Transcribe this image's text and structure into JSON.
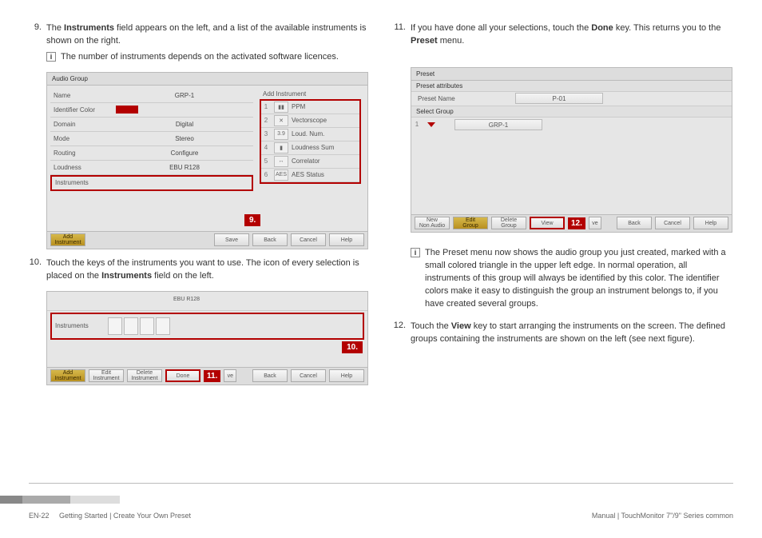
{
  "step9": {
    "num": "9.",
    "text_before": "The ",
    "bold1": "Instruments",
    "text_after": " field appears on the left, and a list of the available instruments is shown on the right."
  },
  "note9": "The number of instruments depends on the activated software licences.",
  "fig9": {
    "title": "Audio Group",
    "rows": {
      "name_lbl": "Name",
      "name_val": "GRP-1",
      "color_lbl": "Identifier Color",
      "domain_lbl": "Domain",
      "domain_val": "Digital",
      "mode_lbl": "Mode",
      "mode_val": "Stereo",
      "routing_lbl": "Routing",
      "routing_val": "Configure",
      "loud_lbl": "Loudness",
      "loud_val": "EBU R128",
      "instr_lbl": "Instruments"
    },
    "add_title": "Add Instrument",
    "items": {
      "n1": "1",
      "t1": "PPM",
      "n2": "2",
      "t2": "Vectorscope",
      "n3": "3",
      "t3": "Loud. Num.",
      "n4": "4",
      "t4": "Loudness Sum",
      "n5": "5",
      "t5": "Correlator",
      "n6": "6",
      "t6": "AES Status"
    },
    "callout": "9.",
    "btns": {
      "add": "Add\nInstrument",
      "save": "Save",
      "back": "Back",
      "cancel": "Cancel",
      "help": "Help"
    }
  },
  "step10": {
    "num": "10.",
    "text_a": "Touch the keys of the instruments you want to use. The icon of every selection is placed on the ",
    "bold": "Instruments",
    "text_b": " field on the left."
  },
  "fig10": {
    "ebu": "EBU R128",
    "lbl": "Instruments",
    "callout10": "10.",
    "callout11": "11.",
    "btns": {
      "add": "Add\nInstrument",
      "edit": "Edit\nInstrument",
      "del": "Delete\nInstrument",
      "done": "Done",
      "ve": "ve",
      "back": "Back",
      "cancel": "Cancel",
      "help": "Help"
    }
  },
  "step11": {
    "num": "11.",
    "a": "If you have done all your selections, touch the ",
    "b1": "Done",
    "b": " key. This returns you to the ",
    "b2": "Preset",
    "c": " menu."
  },
  "fig12": {
    "title": "Preset",
    "sub": "Preset attributes",
    "pname_lbl": "Preset Name",
    "pname_val": "P-01",
    "sel_lbl": "Select Group",
    "g_num": "1",
    "g_val": "GRP-1",
    "callout": "12.",
    "btns": {
      "new": "New\nNon Audio",
      "edit": "Edit\nGroup",
      "del": "Delete\nGroup",
      "view": "View",
      "ve": "ve",
      "back": "Back",
      "cancel": "Cancel",
      "help": "Help"
    }
  },
  "note12": "The Preset menu now shows the audio group you just created, marked with a small colored triangle in the upper left edge. In normal operation, all instruments of this group will always be identified by this color. The identifier colors make it easy to distinguish the group an instrument belongs to, if you have created several groups.",
  "step12": {
    "num": "12.",
    "a": "Touch the ",
    "b1": "View",
    "b": " key to start arranging the instruments on the screen. The defined groups containing the instruments are shown on the left (see next figure)."
  },
  "footer": {
    "left_page": "EN-22",
    "left_crumb": "Getting Started | Create Your Own Preset",
    "right": "Manual | TouchMonitor 7\"/9\" Series common"
  }
}
